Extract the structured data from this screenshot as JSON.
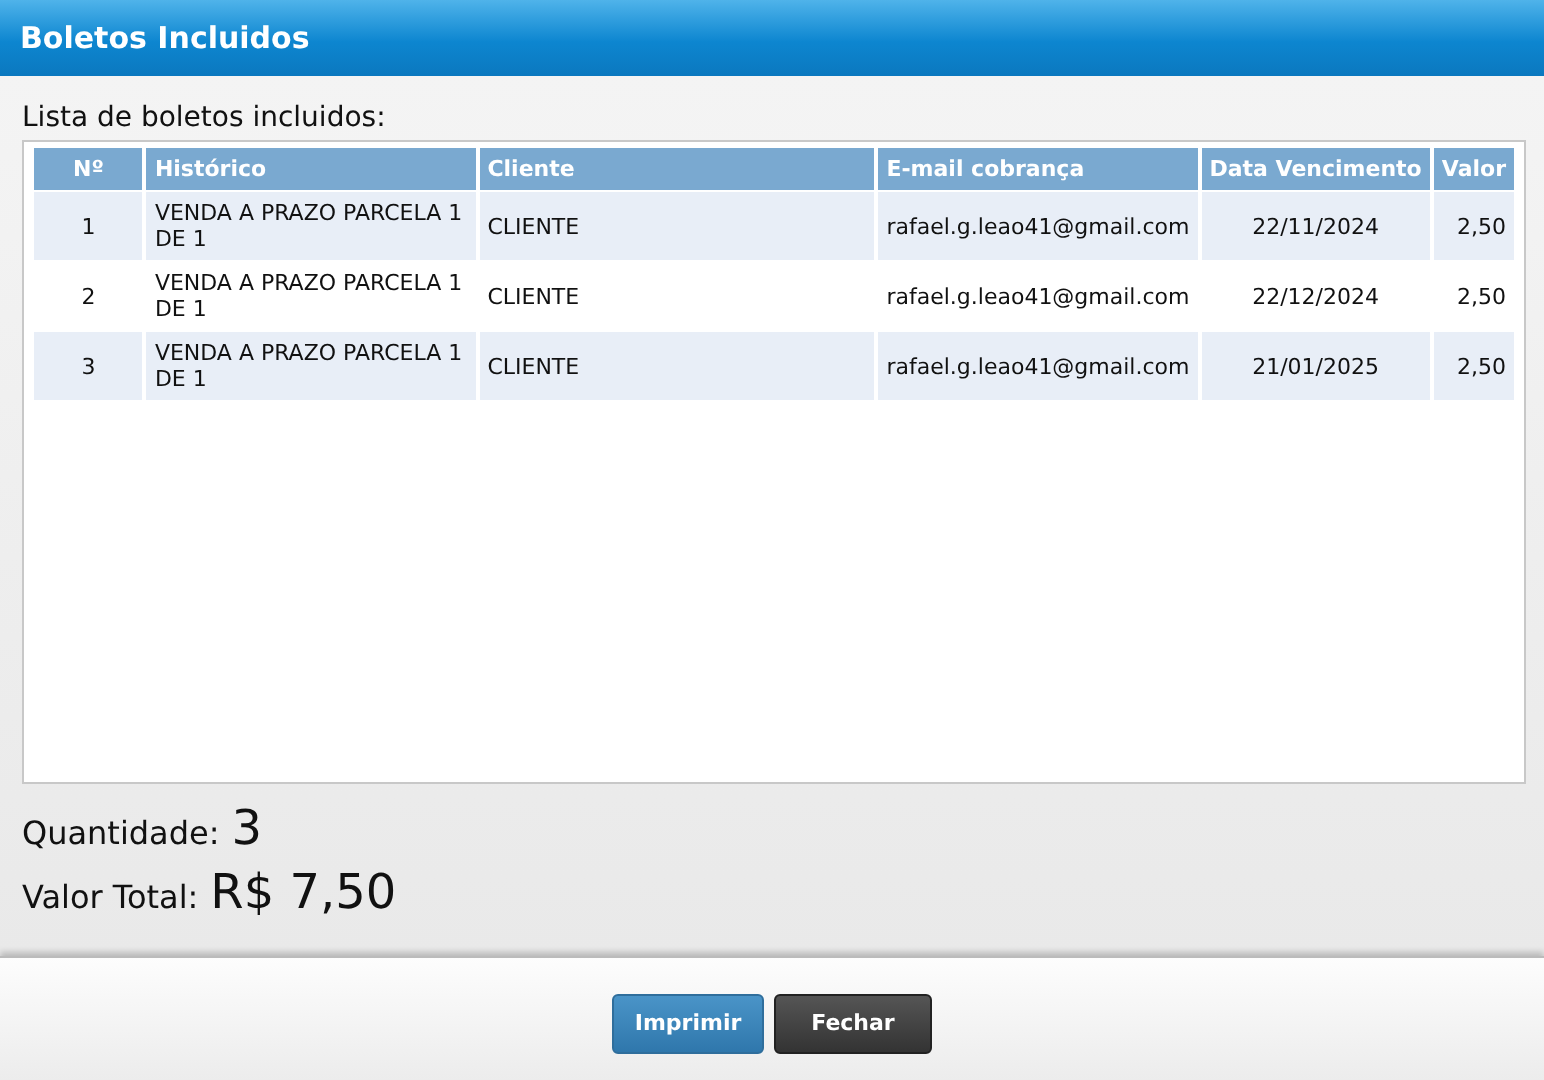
{
  "window": {
    "title": "Boletos Incluidos"
  },
  "list_label": "Lista de boletos incluidos:",
  "table": {
    "columns": [
      "Nº",
      "Histórico",
      "Cliente",
      "E-mail cobrança",
      "Data Vencimento",
      "Valor"
    ],
    "rows": [
      [
        "1",
        "VENDA A PRAZO PARCELA 1 DE 1",
        "CLIENTE",
        "rafael.g.leao41@gmail.com",
        "22/11/2024",
        "2,50"
      ],
      [
        "2",
        "VENDA A PRAZO PARCELA 1 DE 1",
        "CLIENTE",
        "rafael.g.leao41@gmail.com",
        "22/12/2024",
        "2,50"
      ],
      [
        "3",
        "VENDA A PRAZO PARCELA 1 DE 1",
        "CLIENTE",
        "rafael.g.leao41@gmail.com",
        "21/01/2025",
        "2,50"
      ]
    ]
  },
  "summary": [
    {
      "label": "Quantidade:",
      "value": "3"
    },
    {
      "label": "Valor Total:",
      "value": "R$ 7,50"
    }
  ],
  "buttons": [
    {
      "label": "Imprimir",
      "kind": "primary"
    },
    {
      "label": "Fechar",
      "kind": "dark"
    }
  ]
}
